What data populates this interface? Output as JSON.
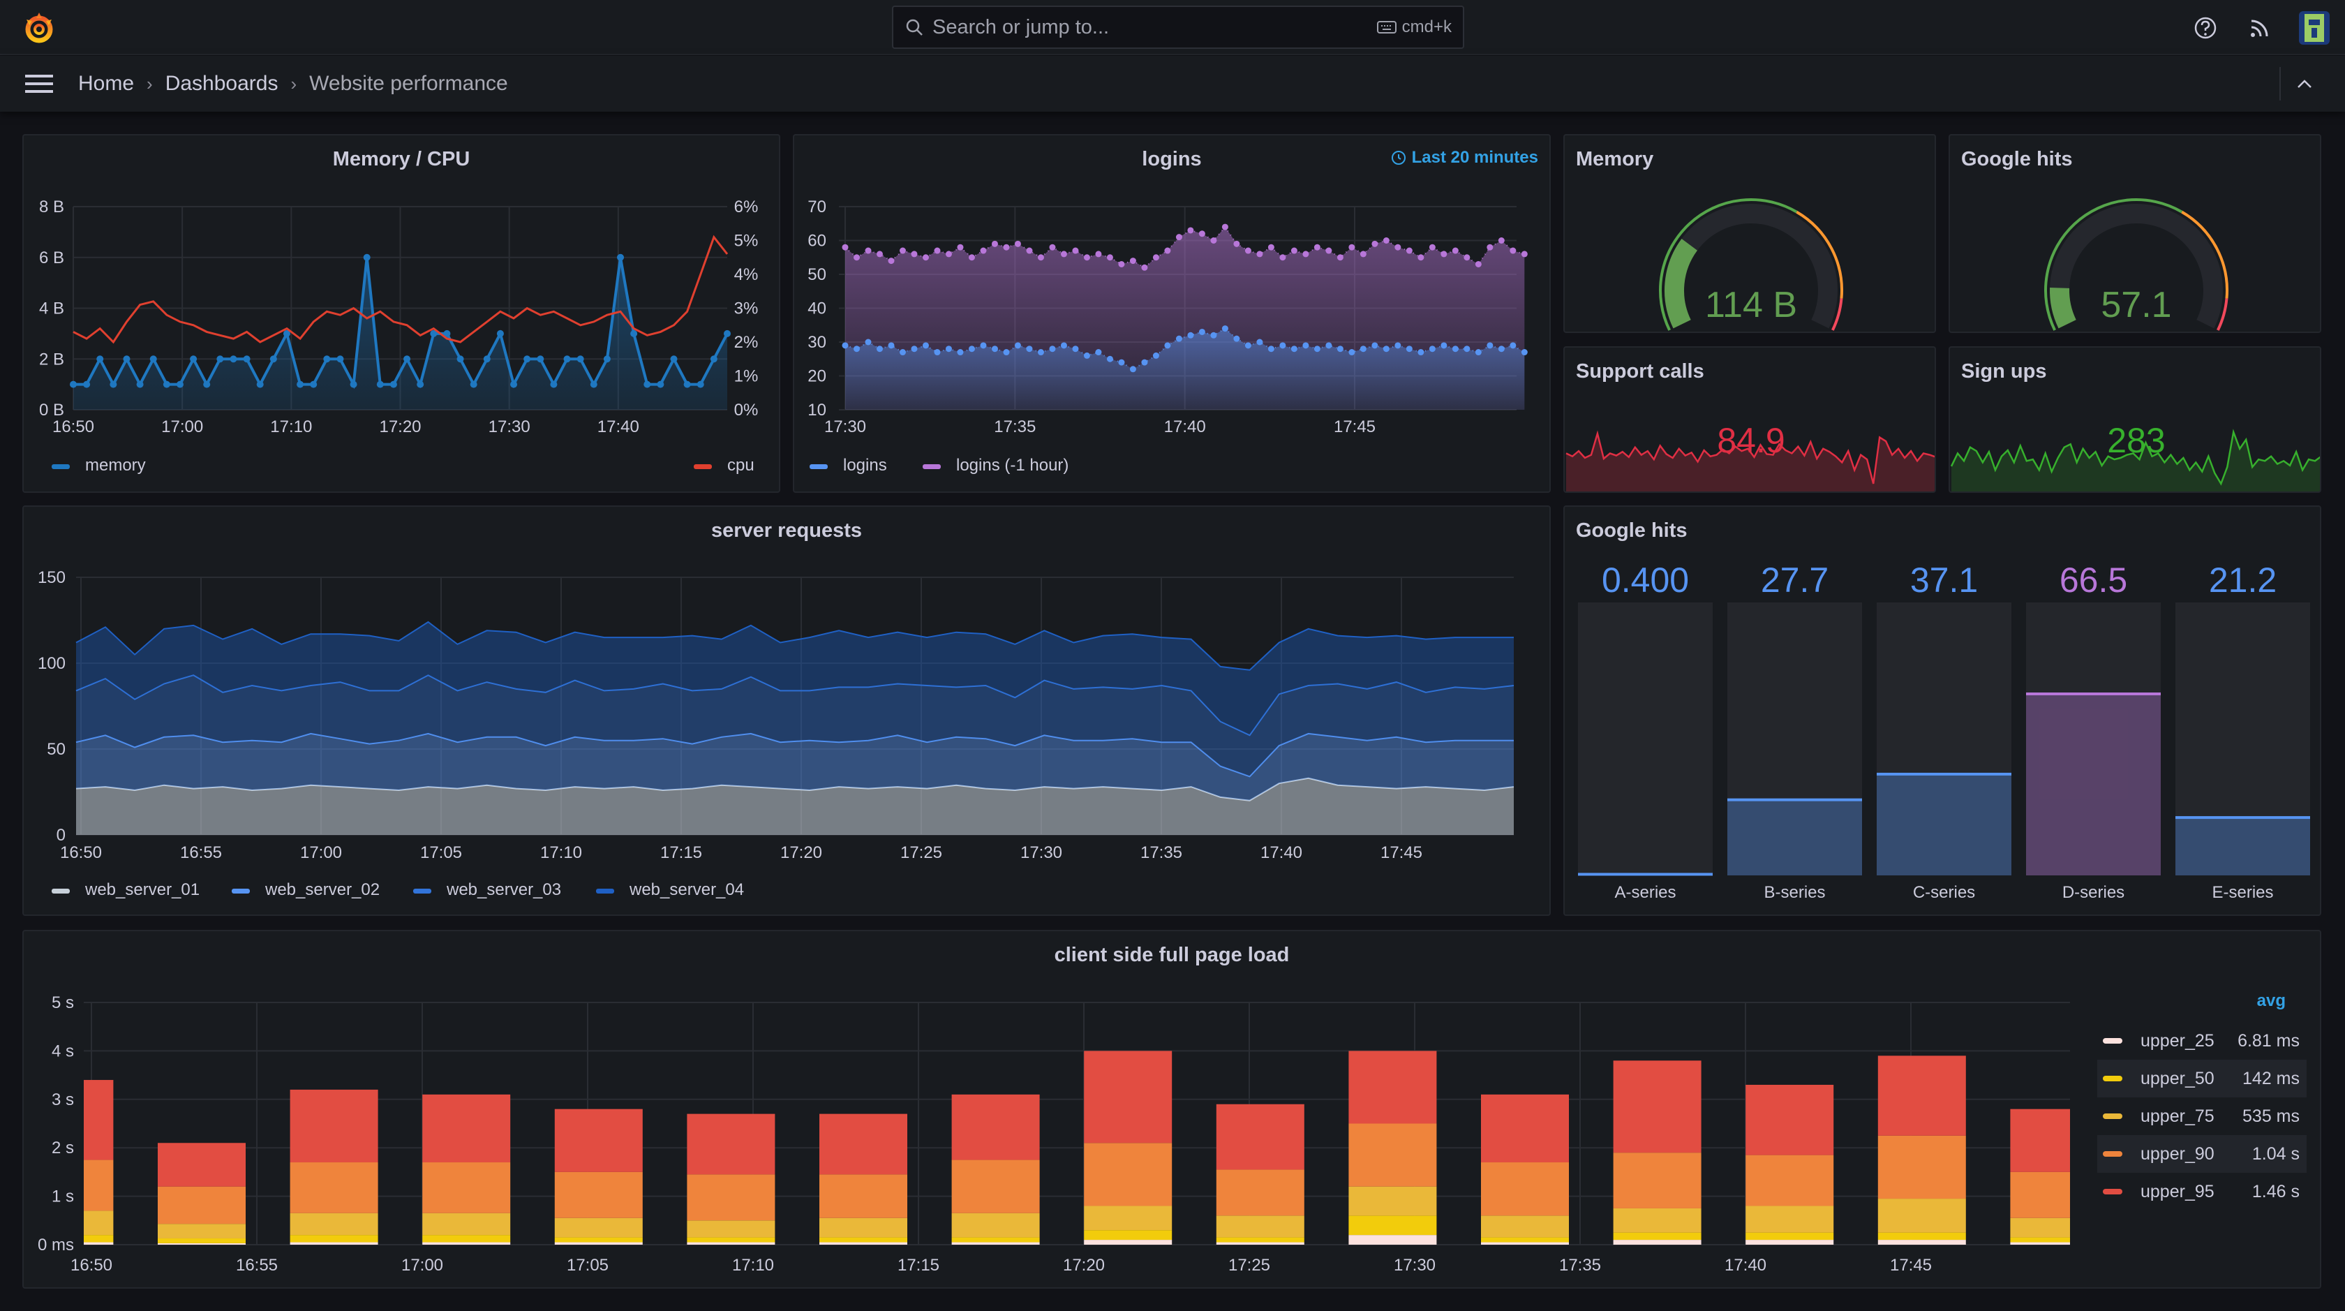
{
  "topbar": {
    "search_placeholder": "Search or jump to...",
    "shortcut": "cmd+k",
    "icons": [
      "grafana-logo",
      "search-icon",
      "keyboard-icon",
      "help-icon",
      "rss-icon",
      "avatar"
    ]
  },
  "breadcrumb": {
    "items": [
      "Home",
      "Dashboards",
      "Website performance"
    ]
  },
  "colors": {
    "background": "#111217",
    "panel": "#181b1f",
    "blue": "#1f78c1",
    "red": "#e0402f",
    "green": "#56a64b",
    "purple": "#b877d9",
    "orange": "#ff9830"
  },
  "panels": {
    "memory_cpu": {
      "title": "Memory / CPU"
    },
    "logins": {
      "title": "logins",
      "time_override": "Last 20 minutes"
    },
    "memory_gauge": {
      "title": "Memory",
      "value": "114 B",
      "fill_percent": 27,
      "thresholds": [
        {
          "from": 0,
          "color": "#56a64b"
        },
        {
          "from": 63,
          "color": "#ff9830"
        },
        {
          "from": 91,
          "color": "#f2495c"
        }
      ]
    },
    "google_hits_gauge": {
      "title": "Google hits",
      "value": "57.1",
      "fill_percent": 12,
      "thresholds": [
        {
          "from": 0,
          "color": "#56a64b"
        },
        {
          "from": 63,
          "color": "#ff9830"
        },
        {
          "from": 91,
          "color": "#f2495c"
        }
      ]
    },
    "support_calls": {
      "title": "Support calls",
      "value": "84.9",
      "color": "#e02f44"
    },
    "sign_ups": {
      "title": "Sign ups",
      "value": "283",
      "color": "#37b02d"
    },
    "server_requests": {
      "title": "server requests"
    },
    "google_hits_bars": {
      "title": "Google hits"
    },
    "client_load": {
      "title": "client side full page load"
    }
  },
  "chart_data": [
    {
      "id": "memory_cpu",
      "type": "line",
      "title": "Memory / CPU",
      "start": "16:50",
      "end": "17:50",
      "x_ticks": [
        "16:50",
        "17:00",
        "17:10",
        "17:20",
        "17:30",
        "17:40"
      ],
      "y_left": {
        "ticks": [
          "0 B",
          "2 B",
          "4 B",
          "6 B",
          "8 B"
        ],
        "range": [
          0,
          8
        ]
      },
      "y_right": {
        "ticks": [
          "0%",
          "1%",
          "2%",
          "3%",
          "4%",
          "5%",
          "6%"
        ],
        "range": [
          0,
          6
        ]
      },
      "grid": true,
      "legend_placement": "bottom",
      "series": [
        {
          "name": "memory",
          "color": "#1f78c1",
          "axis": "left",
          "values": [
            1,
            1,
            2,
            1,
            2,
            1,
            2,
            1,
            1,
            2,
            1,
            2,
            2,
            2,
            1,
            2,
            3,
            1,
            1,
            2,
            2,
            1,
            6,
            1,
            1,
            2,
            1,
            3,
            3,
            2,
            1,
            2,
            3,
            1,
            2,
            2,
            1,
            2,
            2,
            1,
            2,
            6,
            3,
            1,
            1,
            2,
            1,
            1,
            2,
            3
          ]
        },
        {
          "name": "cpu",
          "color": "#e0402f",
          "axis": "right",
          "values": [
            2.3,
            2.1,
            2.4,
            2.0,
            2.6,
            3.1,
            3.2,
            2.8,
            2.6,
            2.5,
            2.3,
            2.2,
            2.1,
            2.3,
            2.0,
            2.2,
            2.4,
            2.1,
            2.6,
            2.9,
            2.8,
            3.0,
            2.7,
            2.9,
            2.6,
            2.5,
            2.2,
            2.4,
            2.1,
            2.0,
            2.3,
            2.6,
            2.9,
            2.7,
            3.0,
            2.8,
            2.9,
            2.7,
            2.5,
            2.6,
            2.8,
            2.9,
            2.4,
            2.2,
            2.3,
            2.5,
            2.9,
            4.0,
            5.1,
            4.6
          ]
        }
      ]
    },
    {
      "id": "logins",
      "type": "line",
      "title": "logins",
      "start": "17:30",
      "end": "17:50",
      "x_ticks": [
        "17:30",
        "17:35",
        "17:40",
        "17:45"
      ],
      "y": {
        "ticks": [
          "10",
          "20",
          "30",
          "40",
          "50",
          "60",
          "70"
        ],
        "range": [
          10,
          70
        ]
      },
      "grid": true,
      "legend_placement": "bottom",
      "series": [
        {
          "name": "logins",
          "color": "#5794f2",
          "values": [
            29,
            28,
            30,
            28,
            29,
            27,
            28,
            29,
            27,
            28,
            27,
            28,
            29,
            28,
            27,
            29,
            28,
            27,
            28,
            29,
            28,
            26,
            27,
            25,
            24,
            22,
            24,
            26,
            29,
            31,
            32,
            33,
            32,
            34,
            31,
            29,
            30,
            28,
            29,
            28,
            29,
            28,
            29,
            28,
            27,
            28,
            29,
            28,
            29,
            28,
            27,
            28,
            29,
            28,
            28,
            27,
            29,
            28,
            29,
            27
          ]
        },
        {
          "name": "logins (-1 hour)",
          "color": "#b877d9",
          "values": [
            58,
            55,
            57,
            56,
            54,
            57,
            56,
            55,
            57,
            56,
            58,
            55,
            57,
            59,
            58,
            59,
            57,
            55,
            58,
            56,
            57,
            55,
            56,
            55,
            53,
            54,
            52,
            55,
            57,
            61,
            63,
            62,
            60,
            64,
            59,
            57,
            56,
            58,
            55,
            57,
            56,
            58,
            57,
            55,
            58,
            56,
            59,
            60,
            58,
            57,
            55,
            58,
            56,
            57,
            55,
            53,
            58,
            60,
            57,
            56
          ]
        }
      ]
    },
    {
      "id": "server_requests",
      "type": "area",
      "stacked": true,
      "title": "server requests",
      "start": "16:50",
      "end": "17:50",
      "x_ticks": [
        "16:50",
        "16:55",
        "17:00",
        "17:05",
        "17:10",
        "17:15",
        "17:20",
        "17:25",
        "17:30",
        "17:35",
        "17:40",
        "17:45"
      ],
      "y": {
        "ticks": [
          "0",
          "50",
          "100",
          "150"
        ],
        "range": [
          0,
          150
        ]
      },
      "grid": true,
      "legend_placement": "bottom",
      "series": [
        {
          "name": "web_server_01",
          "color": "#c7d0d9",
          "values": [
            27,
            28,
            26,
            29,
            27,
            28,
            26,
            27,
            29,
            28,
            27,
            26,
            28,
            27,
            29,
            27,
            26,
            28,
            27,
            28,
            26,
            27,
            29,
            28,
            27,
            26,
            28,
            27,
            28,
            27,
            29,
            27,
            26,
            28,
            27,
            28,
            27,
            26,
            28,
            22,
            20,
            30,
            33,
            29,
            28,
            27,
            28,
            27,
            26,
            28
          ]
        },
        {
          "name": "web_server_02",
          "color": "#5794f2",
          "values": [
            27,
            30,
            25,
            28,
            31,
            26,
            29,
            27,
            30,
            28,
            26,
            29,
            31,
            27,
            28,
            30,
            26,
            29,
            28,
            27,
            30,
            26,
            28,
            31,
            27,
            29,
            26,
            28,
            30,
            27,
            28,
            29,
            26,
            30,
            28,
            27,
            29,
            28,
            26,
            18,
            14,
            22,
            26,
            28,
            27,
            30,
            26,
            28,
            29,
            27
          ]
        },
        {
          "name": "web_server_03",
          "color": "#3274d9",
          "values": [
            30,
            33,
            28,
            31,
            35,
            29,
            32,
            30,
            28,
            33,
            31,
            29,
            34,
            30,
            32,
            28,
            31,
            33,
            29,
            30,
            32,
            31,
            28,
            33,
            30,
            29,
            32,
            31,
            30,
            33,
            29,
            31,
            28,
            32,
            30,
            31,
            29,
            33,
            30,
            26,
            24,
            30,
            28,
            31,
            30,
            32,
            29,
            31,
            30,
            32
          ]
        },
        {
          "name": "web_server_04",
          "color": "#1f60c4",
          "values": [
            28,
            30,
            26,
            32,
            29,
            31,
            33,
            27,
            30,
            28,
            32,
            29,
            31,
            27,
            30,
            33,
            29,
            28,
            31,
            30,
            27,
            32,
            29,
            30,
            28,
            31,
            33,
            29,
            30,
            28,
            32,
            30,
            31,
            29,
            27,
            30,
            32,
            28,
            30,
            32,
            38,
            30,
            33,
            28,
            30,
            27,
            31,
            29,
            30,
            28
          ]
        }
      ]
    },
    {
      "id": "google_hits_bars",
      "type": "bar",
      "title": "Google hits",
      "range": [
        0,
        100
      ],
      "categories": [
        "A-series",
        "B-series",
        "C-series",
        "D-series",
        "E-series"
      ],
      "values": [
        0.4,
        27.7,
        37.1,
        66.5,
        21.2
      ],
      "labels": [
        "0.400",
        "27.7",
        "37.1",
        "66.5",
        "21.2"
      ],
      "colors": [
        "#5794f2",
        "#5794f2",
        "#5794f2",
        "#b877d9",
        "#5794f2"
      ]
    },
    {
      "id": "client_load",
      "type": "bar",
      "stacked": true,
      "title": "client side full page load",
      "x_ticks": [
        "16:50",
        "16:55",
        "17:00",
        "17:05",
        "17:10",
        "17:15",
        "17:20",
        "17:25",
        "17:30",
        "17:35",
        "17:40",
        "17:45"
      ],
      "y": {
        "ticks": [
          "0 ms",
          "1 s",
          "2 s",
          "3 s",
          "4 s",
          "5 s"
        ],
        "range": [
          0,
          5
        ]
      },
      "grid": true,
      "legend_placement": "right",
      "times": [
        "16:49:20",
        "16:53:20",
        "16:57:20",
        "17:01:20",
        "17:05:20",
        "17:09:20",
        "17:13:20",
        "17:17:20",
        "17:21:20",
        "17:25:20",
        "17:29:20",
        "17:33:20",
        "17:37:20",
        "17:41:20",
        "17:45:20",
        "17:49:20"
      ],
      "series": [
        {
          "name": "upper_25",
          "color": "#fce2de",
          "avg": "6.81 ms",
          "values": [
            0.05,
            0.03,
            0.05,
            0.05,
            0.05,
            0.05,
            0.05,
            0.05,
            0.1,
            0.05,
            0.2,
            0.05,
            0.1,
            0.1,
            0.1,
            0.05
          ]
        },
        {
          "name": "upper_50",
          "color": "#f2cc0c",
          "avg": "142 ms",
          "values": [
            0.15,
            0.1,
            0.15,
            0.15,
            0.1,
            0.1,
            0.1,
            0.1,
            0.2,
            0.1,
            0.4,
            0.1,
            0.15,
            0.15,
            0.15,
            0.1
          ]
        },
        {
          "name": "upper_75",
          "color": "#eab839",
          "avg": "535 ms",
          "values": [
            0.5,
            0.3,
            0.45,
            0.45,
            0.4,
            0.35,
            0.4,
            0.5,
            0.5,
            0.45,
            0.6,
            0.45,
            0.5,
            0.55,
            0.7,
            0.4
          ]
        },
        {
          "name": "upper_90",
          "color": "#ef843c",
          "avg": "1.04 s",
          "values": [
            1.05,
            0.77,
            1.05,
            1.05,
            0.95,
            0.95,
            0.9,
            1.1,
            1.3,
            0.95,
            1.3,
            1.1,
            1.15,
            1.05,
            1.3,
            0.95
          ]
        },
        {
          "name": "upper_95",
          "color": "#e24d42",
          "avg": "1.46 s",
          "values": [
            1.65,
            0.9,
            1.5,
            1.4,
            1.3,
            1.25,
            1.25,
            1.35,
            1.9,
            1.35,
            1.5,
            1.4,
            1.9,
            1.45,
            1.65,
            1.3
          ]
        }
      ]
    },
    {
      "id": "support_calls_spark",
      "type": "area",
      "color": "#e02f44",
      "values": [
        52,
        48,
        55,
        46,
        50,
        78,
        45,
        52,
        49,
        54,
        47,
        60,
        50,
        55,
        44,
        62,
        51,
        46,
        58,
        49,
        53,
        41,
        56,
        48,
        50,
        57,
        52,
        61,
        55,
        58,
        47,
        63,
        51,
        50,
        64,
        56,
        52,
        61,
        49,
        67,
        45,
        58,
        54,
        48,
        40,
        55,
        30,
        50,
        44,
        12,
        73,
        68,
        50,
        58,
        46,
        55,
        42,
        52,
        50,
        47
      ]
    },
    {
      "id": "sign_ups_spark",
      "type": "area",
      "color": "#37b02d",
      "values": [
        35,
        52,
        42,
        60,
        55,
        40,
        54,
        30,
        48,
        56,
        40,
        62,
        42,
        44,
        30,
        52,
        28,
        46,
        60,
        64,
        40,
        58,
        46,
        54,
        36,
        48,
        44,
        46,
        50,
        52,
        44,
        66,
        48,
        52,
        40,
        50,
        38,
        46,
        30,
        40,
        28,
        48,
        26,
        12,
        34,
        80,
        58,
        70,
        34,
        44,
        42,
        48,
        38,
        42,
        36,
        54,
        30,
        44,
        42,
        48
      ]
    }
  ]
}
